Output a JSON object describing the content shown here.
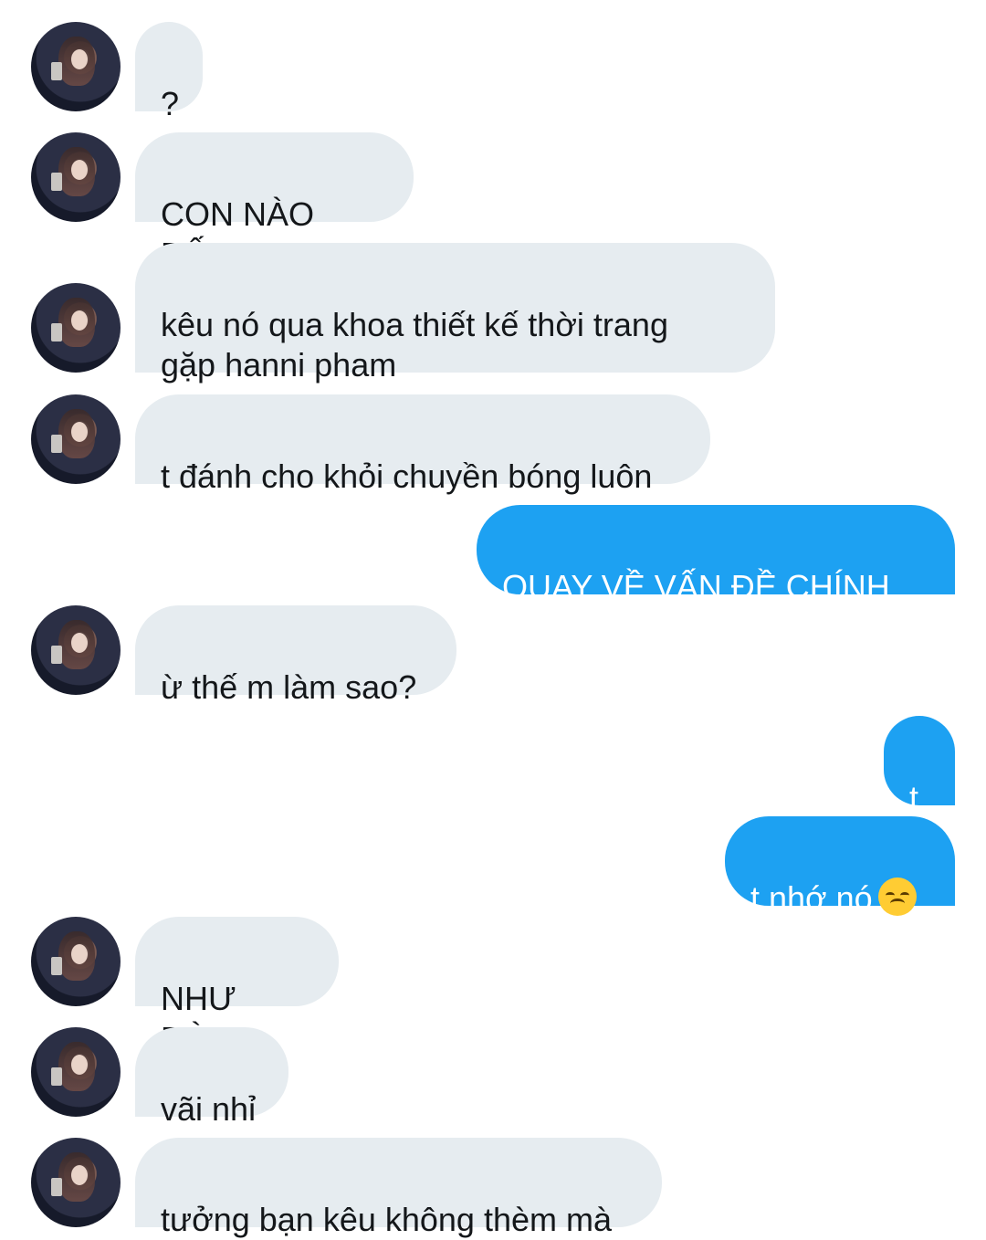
{
  "conversation": {
    "messages": [
      {
        "sender": "them",
        "text": "?"
      },
      {
        "sender": "them",
        "text": "CON NÀO ĐẤY"
      },
      {
        "sender": "them",
        "text": "kêu nó qua khoa thiết kế thời trang\ngặp hanni pham"
      },
      {
        "sender": "them",
        "text": "t đánh cho khỏi chuyền bóng luôn"
      },
      {
        "sender": "me",
        "text": "QUAY VỀ VẤN ĐỀ CHÍNH ĐI"
      },
      {
        "sender": "them",
        "text": "ừ thế m làm sao?"
      },
      {
        "sender": "me",
        "text": "t"
      },
      {
        "sender": "me",
        "text": "t nhớ nó",
        "emoji": "disappointed-face-emoji"
      },
      {
        "sender": "them",
        "text": "NHƯ ĐÙA"
      },
      {
        "sender": "them",
        "text": "vãi nhỉ"
      },
      {
        "sender": "them",
        "text": "tưởng bạn kêu không thèm mà"
      }
    ]
  },
  "colors": {
    "incoming_bubble": "#e6ecf0",
    "outgoing_bubble": "#1da1f2",
    "incoming_text": "#14171a",
    "outgoing_text": "#ffffff"
  }
}
